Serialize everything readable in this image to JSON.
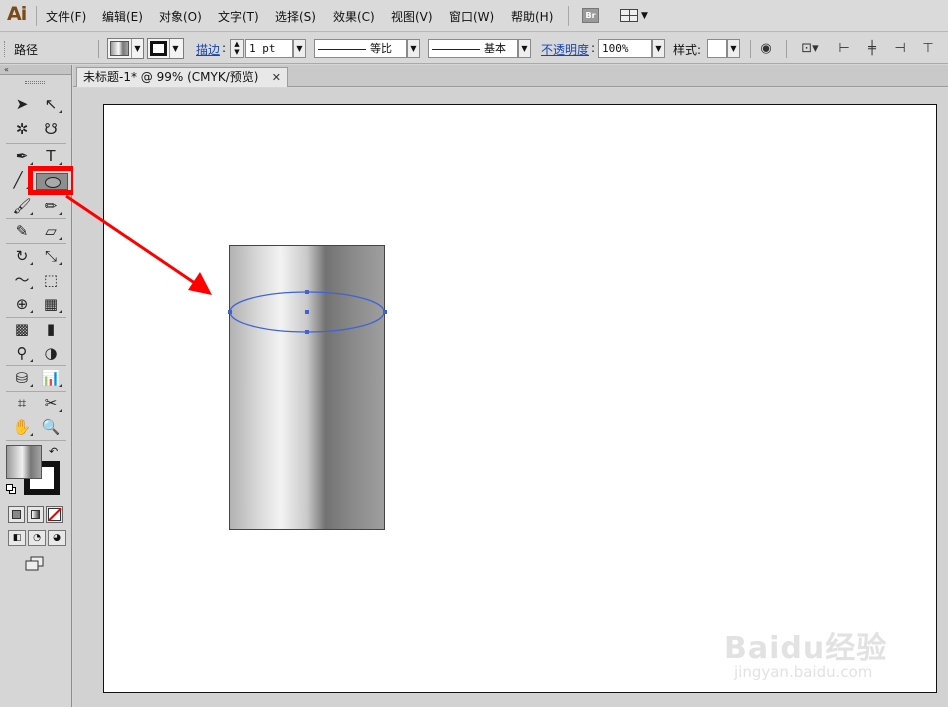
{
  "app": {
    "logo": "Ai"
  },
  "menubar": {
    "items": [
      "文件(F)",
      "编辑(E)",
      "对象(O)",
      "文字(T)",
      "选择(S)",
      "效果(C)",
      "视图(V)",
      "窗口(W)",
      "帮助(H)"
    ],
    "bridge_label": "Br"
  },
  "controlbar": {
    "selection_label": "路径",
    "stroke_link": "描边",
    "stroke_weight": "1 pt",
    "variable_width_label": "等比",
    "brush_label": "基本",
    "opacity_link": "不透明度",
    "opacity_value": "100%",
    "style_label": "样式:"
  },
  "toolbox": {
    "collapse_glyph": "«",
    "active_tool": "ellipse-tool",
    "tools": {
      "selection": "➤",
      "direct_selection": "↖",
      "magic_wand": "✲",
      "lasso": "☋",
      "pen": "✒",
      "type": "T",
      "line": "╱",
      "paintbrush": "🖌",
      "pencil": "✏",
      "blob_brush": "✎",
      "eraser": "▱",
      "rotate": "↻",
      "scale": "⤡",
      "warp": "〜",
      "free_transform": "⬚",
      "shape_builder": "⊕",
      "perspective": "▦",
      "mesh": "▩",
      "gradient": "▮",
      "eyedropper": "⚲",
      "blend": "◑",
      "symbol_sprayer": "⛁",
      "graph": "📊",
      "artboard": "⌗",
      "slice": "✂",
      "hand": "✋",
      "zoom": "🔍"
    },
    "swap_glyph": "↶",
    "draw_modes": [
      "◧",
      "◔",
      "◕"
    ]
  },
  "document": {
    "tab_title": "未标题-1* @ 99% (CMYK/预览)",
    "close_glyph": "✕"
  },
  "colors": {
    "highlight": "#ff0000",
    "annotation_arrow": "#ff0000",
    "selection_path": "#3d63d6",
    "canvas": "#ffffff",
    "pasteboard": "#d2d2d2"
  },
  "watermark": {
    "brand": "Baidu经验",
    "url": "jingyan.baidu.com"
  }
}
